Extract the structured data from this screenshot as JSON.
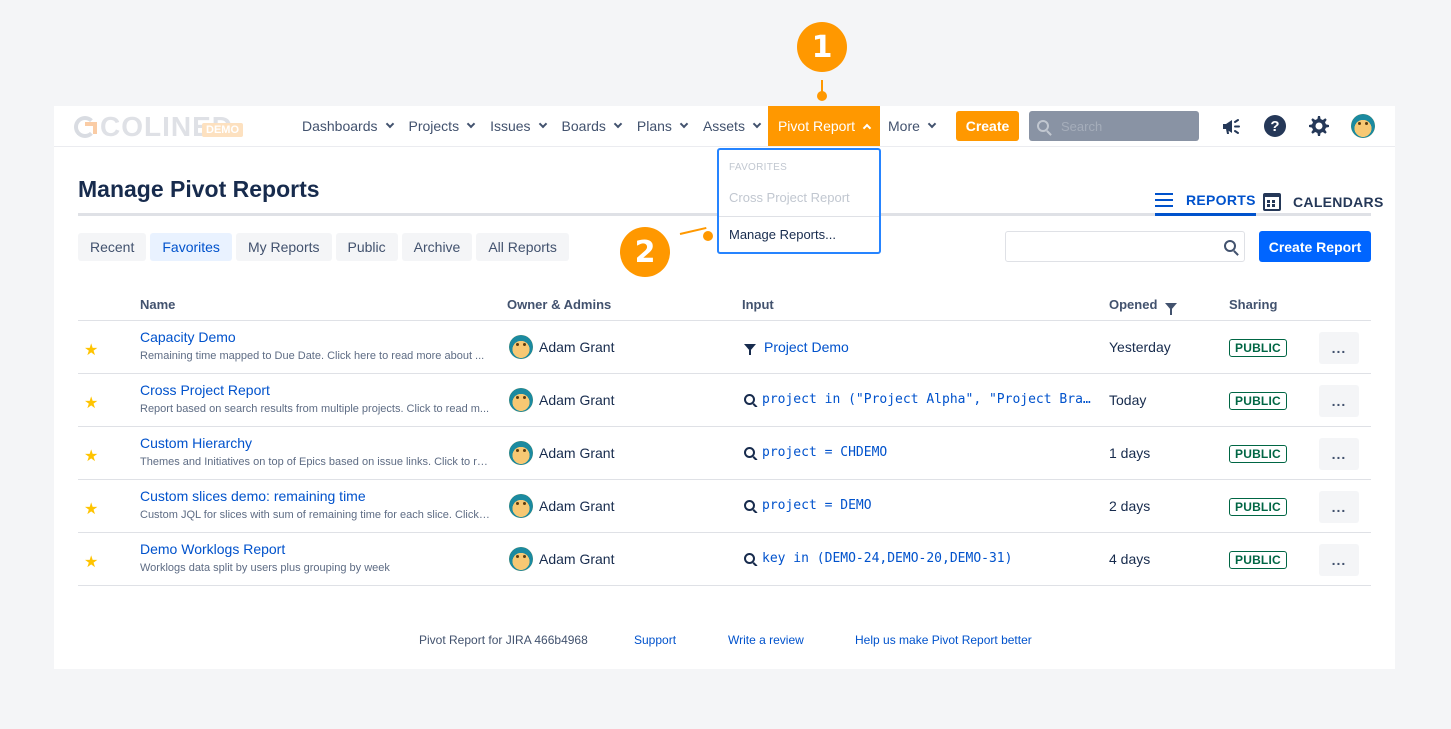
{
  "brand": {
    "name": "COLINED",
    "badge": "DEMO"
  },
  "nav": {
    "items": [
      {
        "id": "dashboards",
        "label": "Dashboards"
      },
      {
        "id": "projects",
        "label": "Projects"
      },
      {
        "id": "issues",
        "label": "Issues"
      },
      {
        "id": "boards",
        "label": "Boards"
      },
      {
        "id": "plans",
        "label": "Plans"
      },
      {
        "id": "assets",
        "label": "Assets"
      },
      {
        "id": "pivot-report",
        "label": "Pivot Report",
        "active": true
      },
      {
        "id": "more",
        "label": "More"
      }
    ],
    "create_label": "Create",
    "search_placeholder": "Search"
  },
  "dropdown": {
    "header": "FAVORITES",
    "favorite_item": "Cross Project Report",
    "manage_item": "Manage Reports..."
  },
  "page": {
    "title": "Manage Pivot Reports",
    "view_tabs": {
      "reports": "REPORTS",
      "calendars": "CALENDARS"
    },
    "filters": [
      "Recent",
      "Favorites",
      "My Reports",
      "Public",
      "Archive",
      "All Reports"
    ],
    "selected_filter": "Favorites",
    "create_report_label": "Create Report"
  },
  "table": {
    "headers": {
      "name": "Name",
      "owner": "Owner & Admins",
      "input": "Input",
      "opened": "Opened",
      "sharing": "Sharing"
    },
    "rows": [
      {
        "name": "Capacity Demo",
        "desc": "Remaining time mapped to Due Date. Click here to read more about ...",
        "owner": "Adam Grant",
        "input_type": "filter",
        "input": "Project Demo",
        "opened": "Yesterday",
        "sharing": "PUBLIC"
      },
      {
        "name": "Cross Project Report",
        "desc": "Report based on search results from multiple projects. Click to read m...",
        "owner": "Adam Grant",
        "input_type": "jql",
        "input": "project in (\"Project Alpha\", \"Project Bra...",
        "opened": "Today",
        "sharing": "PUBLIC"
      },
      {
        "name": "Custom Hierarchy",
        "desc": "Themes and Initiatives on top of Epics based on issue links. Click to re...",
        "owner": "Adam Grant",
        "input_type": "jql",
        "input": "project = CHDEMO",
        "opened": "1 days",
        "sharing": "PUBLIC"
      },
      {
        "name": "Custom slices demo: remaining time",
        "desc": "Custom JQL for slices with sum of remaining time for each slice. Click ...",
        "owner": "Adam Grant",
        "input_type": "jql",
        "input": "project = DEMO",
        "opened": "2 days",
        "sharing": "PUBLIC"
      },
      {
        "name": "Demo Worklogs Report",
        "desc": "Worklogs data split by users plus grouping by week",
        "owner": "Adam Grant",
        "input_type": "jql",
        "input": "key in (DEMO-24,DEMO-20,DEMO-31)",
        "opened": "4 days",
        "sharing": "PUBLIC"
      }
    ],
    "more_label": "..."
  },
  "footer": {
    "version": "Pivot Report for JIRA 466b4968",
    "support": "Support",
    "review": "Write a review",
    "feedback": "Help us make Pivot Report better"
  },
  "callouts": {
    "step1": "1",
    "step2": "2"
  },
  "colors": {
    "accent": "#ff9800",
    "primary": "#0065ff",
    "link": "#0052cc",
    "public_badge": "#006644"
  },
  "icons": [
    "megaphone-icon",
    "help-icon",
    "gear-icon",
    "avatar",
    "list-icon",
    "calendar-icon",
    "search-icon",
    "filter-icon",
    "star-icon"
  ]
}
